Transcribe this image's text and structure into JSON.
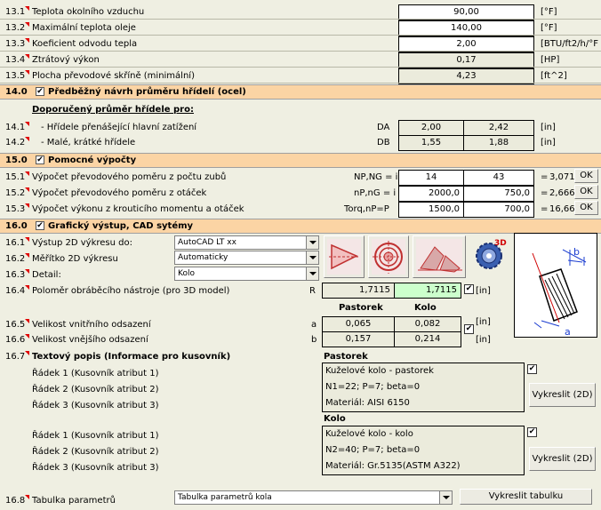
{
  "rows_top": [
    {
      "num": "13.1",
      "label": "Teplota okolního vzduchu",
      "value": "90,00",
      "unit": "[°F]"
    },
    {
      "num": "13.2",
      "label": "Maximální teplota oleje",
      "value": "140,00",
      "unit": "[°F]"
    },
    {
      "num": "13.3",
      "label": "Koeficient odvodu tepla",
      "value": "2,00",
      "unit": "[BTU/ft2/h/°F"
    },
    {
      "num": "13.4",
      "label": "Ztrátový výkon",
      "value": "0,17",
      "unit": "[HP]"
    },
    {
      "num": "13.5",
      "label": "Plocha převodové skříně (minimální)",
      "value": "4,23",
      "unit": "[ft^2]"
    }
  ],
  "sec14": {
    "num": "14.0",
    "title": "Předběžný návrh průměru hřídelí (ocel)",
    "subtitle": "Doporučený průměr hřídele pro:",
    "rows": [
      {
        "num": "14.1",
        "label": "- Hřídele přenášející hlavní zatížení",
        "code": "DA",
        "v1": "2,00",
        "v2": "2,42",
        "unit": "[in]"
      },
      {
        "num": "14.2",
        "label": "- Malé, krátké hřídele",
        "code": "DB",
        "v1": "1,55",
        "v2": "1,88",
        "unit": "[in]"
      }
    ]
  },
  "sec15": {
    "num": "15.0",
    "title": "Pomocné výpočty",
    "rows": [
      {
        "num": "15.1",
        "label": "Výpočet převodového poměru z počtu zubů",
        "code": "NP,NG = i",
        "v1": "14",
        "v2": "43",
        "eq": "=",
        "res": "3,0714",
        "btn": "OK"
      },
      {
        "num": "15.2",
        "label": "Výpočet převodového poměru z otáček",
        "code": "nP,nG = i",
        "v1": "2000,0",
        "v2": "750,0",
        "eq": "=",
        "res": "2,6667",
        "btn": "OK"
      },
      {
        "num": "15.3",
        "label": "Výpočet výkonu z krouticího momentu a otáček",
        "code": "Torq,nP=P",
        "v1": "1500,0",
        "v2": "700,0",
        "eq": "=",
        "res": "16,666",
        "btn": "OK"
      }
    ]
  },
  "sec16": {
    "num": "16.0",
    "title": "Grafický výstup, CAD sytémy",
    "r1": {
      "num": "16.1",
      "label": "Výstup 2D výkresu do:",
      "value": "AutoCAD LT xx"
    },
    "r2": {
      "num": "16.2",
      "label": "Měřítko 2D výkresu",
      "value": "Automaticky"
    },
    "r3": {
      "num": "16.3",
      "label": "Detail:",
      "value": "Kolo"
    },
    "r4": {
      "num": "16.4",
      "label": "Poloměr obráběcího nástroje (pro 3D model)",
      "code": "R",
      "v1": "1,7115",
      "v2": "1,7115",
      "unit": "[in]"
    },
    "col_pastorek": "Pastorek",
    "col_kolo": "Kolo",
    "r5": {
      "num": "16.5",
      "label": "Velikost vnitřního odsazení",
      "code": "a",
      "v1": "0,065",
      "v2": "0,082",
      "unit": "[in]"
    },
    "r6": {
      "num": "16.6",
      "label": "Velikost vnějšího odsazení",
      "code": "b",
      "v1": "0,157",
      "v2": "0,214",
      "unit": "[in]"
    },
    "r7": {
      "num": "16.7",
      "label": "Textový popis (Informace pro kusovník)",
      "heading_p": "Pastorek",
      "heading_k": "Kolo"
    },
    "attr_labels": [
      "Řádek 1 (Kusovník atribut 1)",
      "Řádek 2 (Kusovník atribut 2)",
      "Řádek 3 (Kusovník atribut 3)"
    ],
    "pastorek_text": [
      "Kuželové kolo - pastorek",
      "N1=22; P=7; beta=0",
      "Materiál: AISI 6150"
    ],
    "kolo_text": [
      "Kuželové kolo - kolo",
      "N2=40; P=7; beta=0",
      "Materiál: Gr.5135(ASTM A322)"
    ],
    "draw_btn": "Vykreslit (2D)",
    "r8": {
      "num": "16.8",
      "label": "Tabulka parametrů",
      "value": "Tabulka parametrů kola",
      "btn": "Vykreslit tabulku"
    },
    "fig_labels": {
      "b": "b",
      "a": "a"
    },
    "cad_3d": "3D"
  },
  "colors": {
    "section_header": "#fbd4a4",
    "input_green": "#ccffcc",
    "cell_bg": "#ebebdc",
    "background": "#efefe2"
  }
}
